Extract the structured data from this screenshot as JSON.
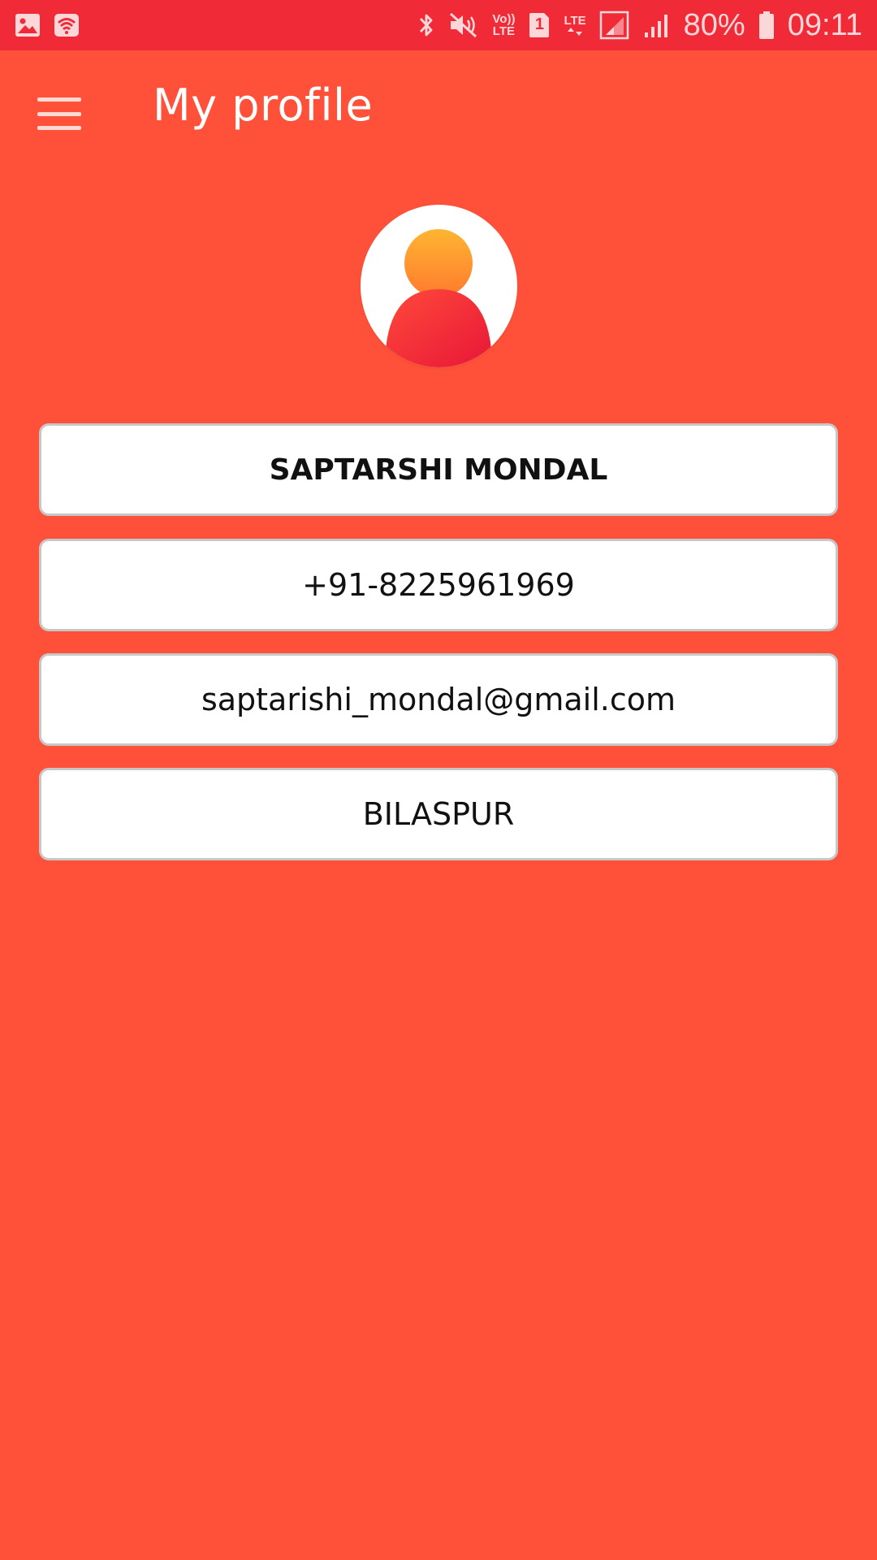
{
  "status_bar": {
    "battery_percent": "80%",
    "time": "09:11",
    "volte_top": "Vo))",
    "volte_bottom": "LTE",
    "sim_slot": "1",
    "lte_label": "LTE",
    "icons": [
      "gallery-icon",
      "wifi-notification-icon",
      "bluetooth-icon",
      "mute-icon",
      "volte-icon",
      "sim-icon",
      "lte-icon",
      "signal-icon",
      "signal-icon",
      "battery-icon"
    ]
  },
  "toolbar": {
    "title": "My profile",
    "menu_icon": "hamburger-menu-icon"
  },
  "profile": {
    "avatar_icon": "user-avatar-icon",
    "name": "SAPTARSHI MONDAL",
    "phone": "+91-8225961969",
    "email": "saptarishi_mondal@gmail.com",
    "city": "BILASPUR"
  },
  "colors": {
    "background": "#FF5139",
    "status_bar": "#F02A37",
    "field_background": "#FFFFFF",
    "field_border": "#C7C7C7",
    "avatar_head": "#FFA531",
    "avatar_body": "#F0233B"
  }
}
